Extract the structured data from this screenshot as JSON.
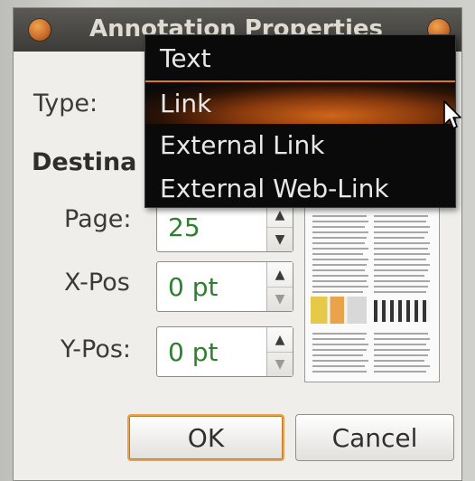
{
  "dialog": {
    "title": "Annotation Properties",
    "type_label": "Type:",
    "destination_label": "Destina",
    "page": {
      "label": "Page:",
      "value": "25"
    },
    "x_pos": {
      "label": "X-Pos",
      "value": "0 pt"
    },
    "y_pos": {
      "label": "Y-Pos:",
      "value": "0 pt"
    },
    "ok_label": "OK",
    "cancel_label": "Cancel"
  },
  "type_dropdown": {
    "options": [
      "Text",
      "Link",
      "External Link",
      "External Web-Link"
    ],
    "selected": "Link"
  },
  "colors": {
    "selection_highlight": "#d0661a",
    "default_button_border": "#e8a04a",
    "field_value_text": "#2f7f2f"
  }
}
